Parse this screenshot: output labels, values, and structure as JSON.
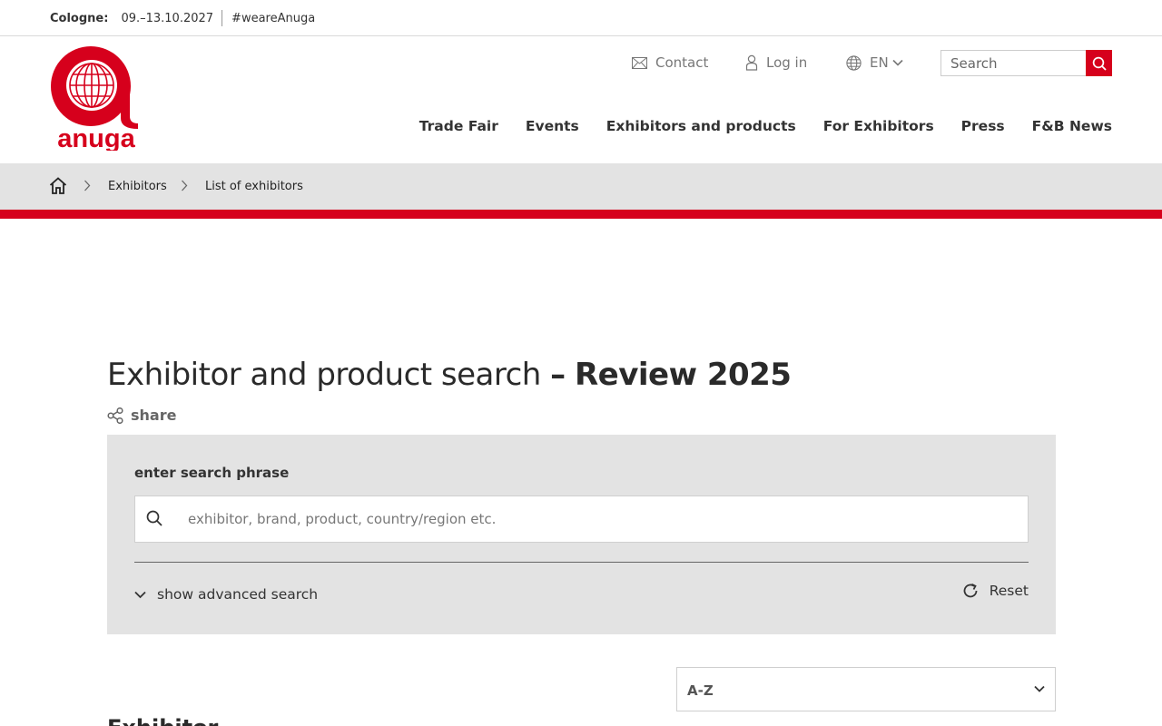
{
  "infobar": {
    "city": "Cologne:",
    "dates": "09.–13.10.2027",
    "hashtag": "#weareAnuga"
  },
  "brand": {
    "logo_text": "anuga",
    "accent": "#d6001c"
  },
  "utility": {
    "contact": "Contact",
    "login": "Log in",
    "language": "EN",
    "search_placeholder": "Search"
  },
  "nav": {
    "items": [
      "Trade Fair",
      "Events",
      "Exhibitors and products",
      "For Exhibitors",
      "Press",
      "F&B News"
    ]
  },
  "breadcrumb": {
    "items": [
      "Exhibitors",
      "List of exhibitors"
    ]
  },
  "page": {
    "title_main": "Exhibitor and product search",
    "title_dash": "–",
    "title_bold": "Review 2025",
    "share": "share"
  },
  "search_panel": {
    "label": "enter search phrase",
    "placeholder": "exhibitor, brand, product, country/region etc.",
    "advanced": "show advanced search",
    "reset": "Reset"
  },
  "sort": {
    "selected": "A-Z"
  },
  "results": {
    "heading": "Exhibitor"
  }
}
